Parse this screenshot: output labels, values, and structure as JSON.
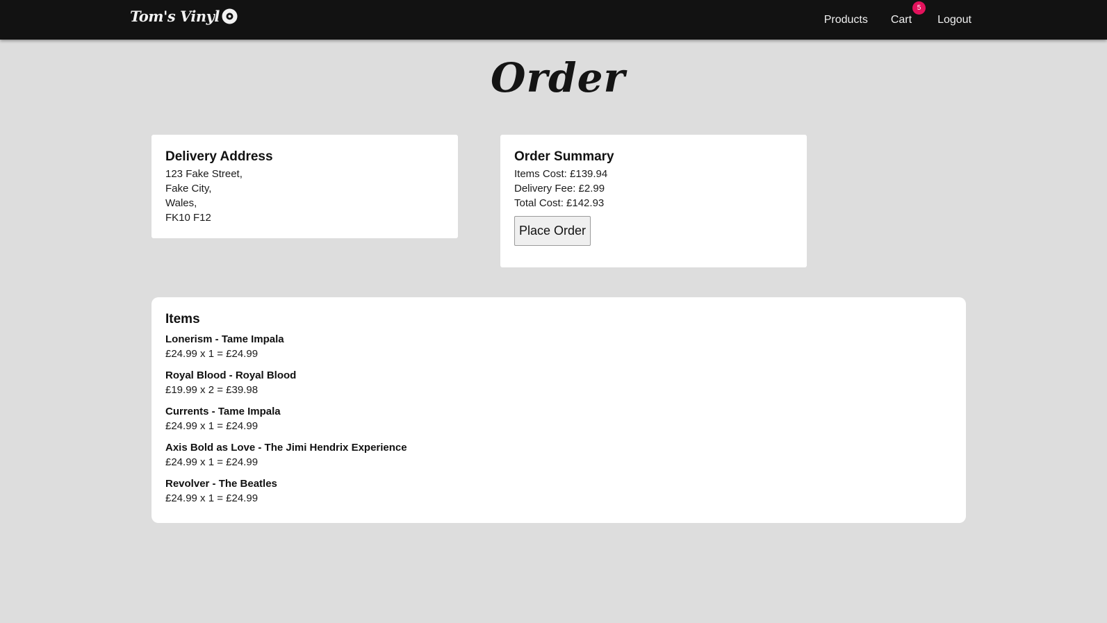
{
  "navbar": {
    "brand": "Tom's Vinyl",
    "brand_icon": "vinyl-record-icon",
    "links": {
      "products": "Products",
      "cart": "Cart",
      "logout": "Logout"
    },
    "cart_count": "5",
    "badge_color": "#e3125c",
    "background": "#121212"
  },
  "page": {
    "title": "Order",
    "background": "#dddddd"
  },
  "delivery": {
    "heading": "Delivery Address",
    "lines": [
      "123 Fake Street,",
      "Fake City,",
      "Wales,",
      "FK10 F12"
    ]
  },
  "summary": {
    "heading": "Order Summary",
    "items_cost": "Items Cost: £139.94",
    "delivery_fee": "Delivery Fee: £2.99",
    "total_cost": "Total Cost: £142.93",
    "button_label": "Place Order"
  },
  "items": {
    "heading": "Items",
    "list": [
      {
        "title": "Lonerism - Tame Impala",
        "price": "£24.99 x 1 = £24.99"
      },
      {
        "title": "Royal Blood - Royal Blood",
        "price": "£19.99 x 2 = £39.98"
      },
      {
        "title": "Currents - Tame Impala",
        "price": "£24.99 x 1 = £24.99"
      },
      {
        "title": "Axis Bold as Love - The Jimi Hendrix Experience",
        "price": "£24.99 x 1 = £24.99"
      },
      {
        "title": "Revolver - The Beatles",
        "price": "£24.99 x 1 = £24.99"
      }
    ]
  }
}
